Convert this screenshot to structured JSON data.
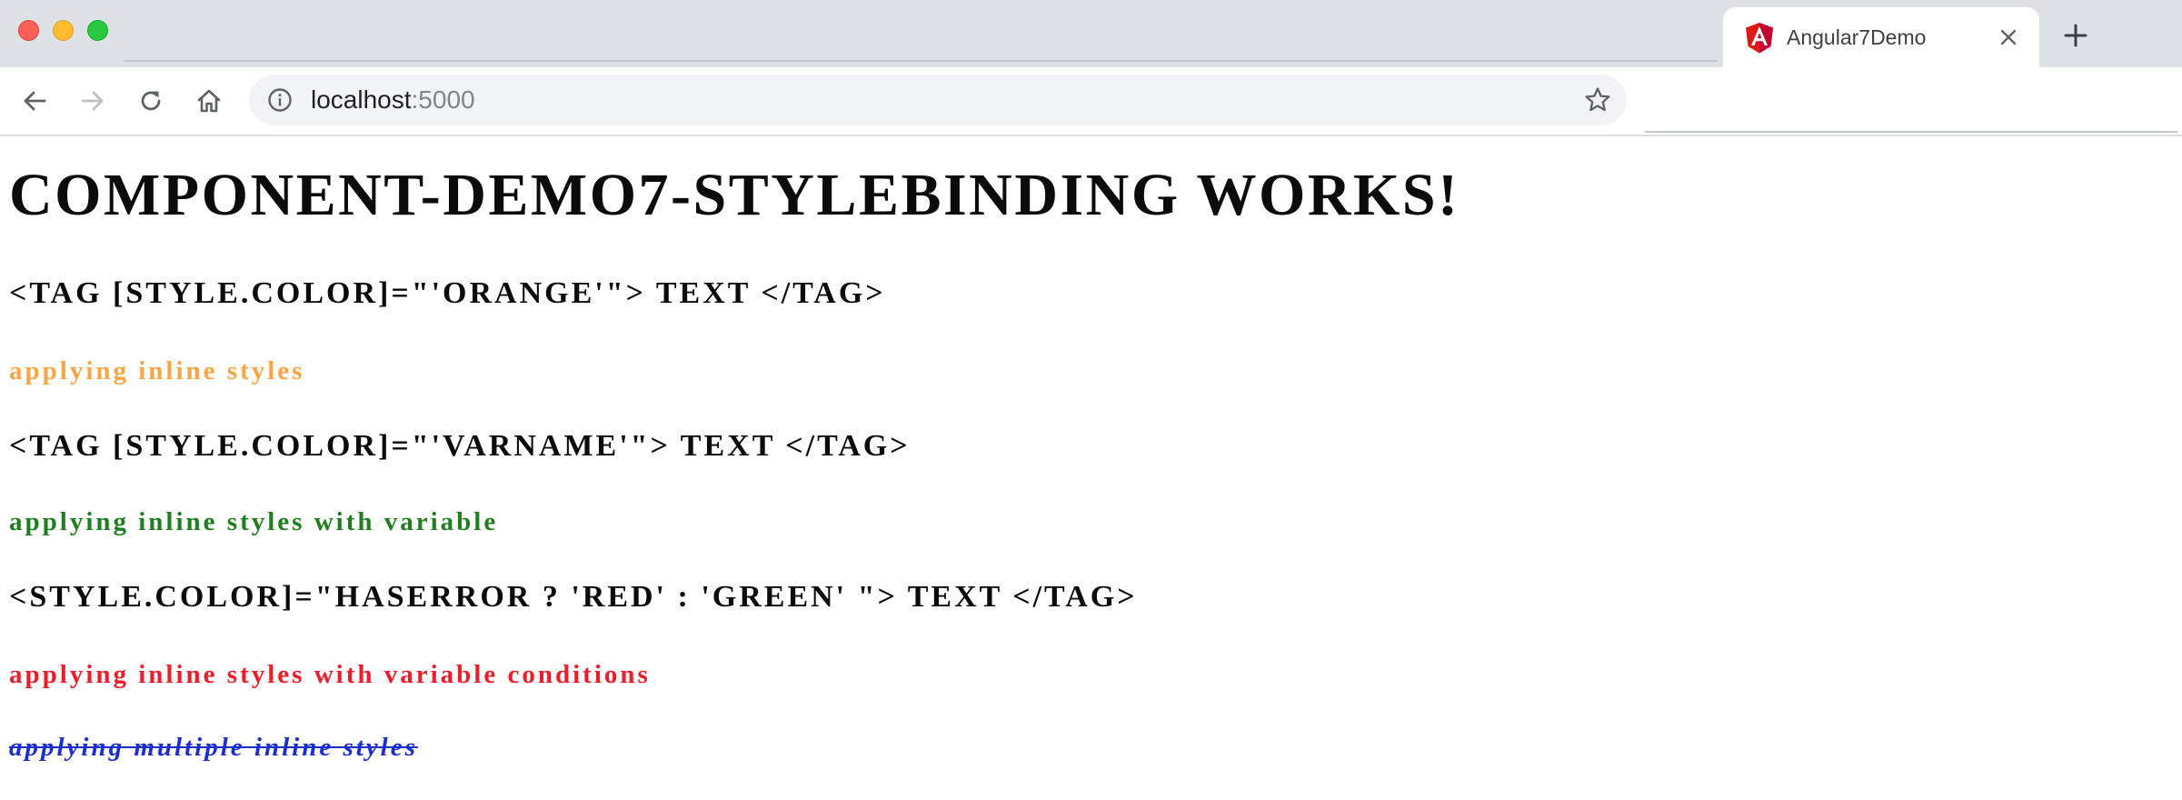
{
  "browser": {
    "tab": {
      "title": "Angular7Demo",
      "icon": "angular-icon"
    },
    "address_bar": {
      "host": "localhost",
      "port": ":5000"
    },
    "icons": {
      "back": "arrow-left-icon",
      "forward": "arrow-right-icon",
      "reload": "reload-icon",
      "home": "home-icon",
      "info": "info-icon",
      "bookmark": "star-icon",
      "close_tab": "close-icon",
      "new_tab": "plus-icon"
    },
    "colors": {
      "tabstrip": "#dee1e6",
      "omnibox": "#f1f3f4",
      "angular_red": "#dd1b16"
    }
  },
  "page": {
    "heading": "component-demo7-stylebinding works!",
    "section1": {
      "heading": "<tag [style.color]=\"'orange'\"> text </tag>",
      "text": "applying inline styles",
      "color": "#f7a545"
    },
    "section2": {
      "heading": "<tag [style.color]=\"'varName'\"> text </tag>",
      "text": "applying inline styles with variable",
      "color": "#207e20"
    },
    "section3": {
      "heading": "<style.color]=\"hasError ? 'red' : 'green' \"> text </tag>",
      "text": "applying inline styles with variable conditions",
      "color": "#ee1d2c"
    },
    "section4": {
      "text": "applying multiple inline styles",
      "color": "#1b2ed0"
    }
  }
}
